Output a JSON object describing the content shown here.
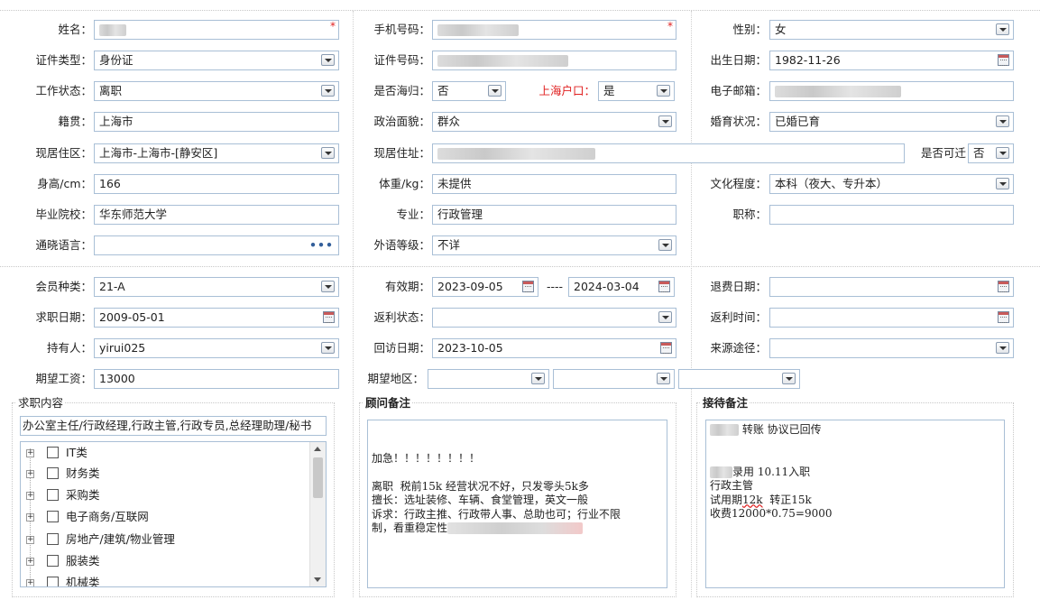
{
  "basic": {
    "name": {
      "label": "姓名："
    },
    "mobile": {
      "label": "手机号码："
    },
    "gender": {
      "label": "性别：",
      "value": "女"
    },
    "id_type": {
      "label": "证件类型：",
      "value": "身份证"
    },
    "id_number": {
      "label": "证件号码："
    },
    "birth_date": {
      "label": "出生日期：",
      "value": "1982-11-26"
    },
    "work_status": {
      "label": "工作状态：",
      "value": "离职"
    },
    "returnee": {
      "label": "是否海归：",
      "value": "否"
    },
    "sh_hukou": {
      "label": "上海户口：",
      "value": "是"
    },
    "email": {
      "label": "电子邮箱："
    },
    "native_place": {
      "label": "籍贯：",
      "value": "上海市"
    },
    "political": {
      "label": "政治面貌：",
      "value": "群众"
    },
    "marital": {
      "label": "婚育状况：",
      "value": "已婚已育"
    },
    "residence_area": {
      "label": "现居住区：",
      "value": "上海市-上海市-[静安区]"
    },
    "residence_addr": {
      "label": "现居住址："
    },
    "relocate": {
      "label": "是否可迁",
      "value": "否"
    },
    "height": {
      "label": "身高/cm：",
      "value": "166"
    },
    "weight": {
      "label": "体重/kg：",
      "value": "未提供"
    },
    "education": {
      "label": "文化程度：",
      "value": "本科（夜大、专升本）"
    },
    "school": {
      "label": "毕业院校：",
      "value": "华东师范大学"
    },
    "major": {
      "label": "专业：",
      "value": "行政管理"
    },
    "title": {
      "label": "职称：",
      "value": ""
    },
    "languages": {
      "label": "通晓语言：",
      "value": "",
      "more_icon": "•••"
    },
    "foreign_level": {
      "label": "外语等级：",
      "value": "不详"
    }
  },
  "membership": {
    "member_type": {
      "label": "会员种类：",
      "value": "21-A"
    },
    "valid_period": {
      "label": "有效期：",
      "start": "2023-09-05",
      "separator": "----",
      "end": "2024-03-04"
    },
    "refund_date": {
      "label": "退费日期：",
      "value": ""
    },
    "job_date": {
      "label": "求职日期：",
      "value": "2009-05-01"
    },
    "rebate_status": {
      "label": "返利状态：",
      "value": ""
    },
    "rebate_time": {
      "label": "返利时间：",
      "value": ""
    },
    "holder": {
      "label": "持有人：",
      "value": "yirui025"
    },
    "visit_date": {
      "label": "回访日期：",
      "value": "2023-10-05"
    },
    "source": {
      "label": "来源途径：",
      "value": ""
    },
    "salary": {
      "label": "期望工资：",
      "value": "13000"
    },
    "region": {
      "label": "期望地区：",
      "value1": "",
      "value2": "",
      "value3": ""
    }
  },
  "job_content": {
    "legend": "求职内容",
    "summary": "办公室主任/行政经理,行政主管,行政专员,总经理助理/秘书",
    "tree": [
      "IT类",
      "财务类",
      "采购类",
      "电子商务/互联网",
      "房地产/建筑/物业管理",
      "服装类",
      "机械类"
    ]
  },
  "consultant_notes": {
    "legend": "顾问备注",
    "line1": "加急！！！！！！！！",
    "line2": "离职  税前15k 经营状况不好，只发零头5k多",
    "line3": "擅长：选址装修、车辆、食堂管理，英文一般",
    "line4": "诉求：行政主推、行政带人事、总助也可；行业不限",
    "line5": "制，看重稳定性"
  },
  "reception_notes": {
    "legend": "接待备注",
    "line1": "转账 协议已回传",
    "line2": "录用 10.11入职",
    "line3": "行政主管",
    "line4a": "试用期",
    "line4b": "12k",
    "line4c": "  转正15k",
    "line5": "收费12000*0.75=9000"
  }
}
